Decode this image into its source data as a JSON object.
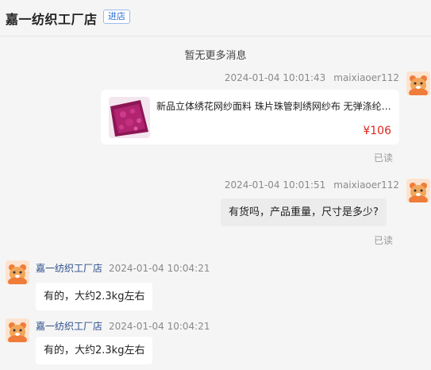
{
  "header": {
    "shop_name": "嘉一纺织工厂店",
    "enter_shop_label": "进店"
  },
  "notice": {
    "no_more_messages": "暂无更多消息"
  },
  "messages": [
    {
      "direction": "out",
      "timestamp": "2024-01-04 10:01:43",
      "sender": "maixiaoer112",
      "type": "product",
      "product": {
        "title": "新品立体绣花网纱面料 珠片珠管刺绣网纱布 无弹涤纶…",
        "price": "¥106"
      },
      "status": "已读"
    },
    {
      "direction": "out",
      "timestamp": "2024-01-04 10:01:51",
      "sender": "maixiaoer112",
      "type": "text",
      "text": "有货吗，产品重量，尺寸是多少?",
      "status": "已读"
    },
    {
      "direction": "in",
      "sender": "嘉一纺织工厂店",
      "timestamp": "2024-01-04 10:04:21",
      "type": "text",
      "text": "有的，大约2.3kg左右"
    },
    {
      "direction": "in",
      "sender": "嘉一纺织工厂店",
      "timestamp": "2024-01-04 10:04:21",
      "type": "text",
      "text": "有的，大约2.3kg左右"
    }
  ],
  "colors": {
    "background": "#f5f5f5",
    "price": "#e0251c",
    "link_name": "#2b4e8c",
    "enter_shop": "#2a6fd6",
    "avatar_orange": "#f07c3a"
  },
  "icons": {
    "avatar": "cartoon-bear-avatar-icon",
    "product_thumb": "lace-fabric-thumbnail"
  }
}
